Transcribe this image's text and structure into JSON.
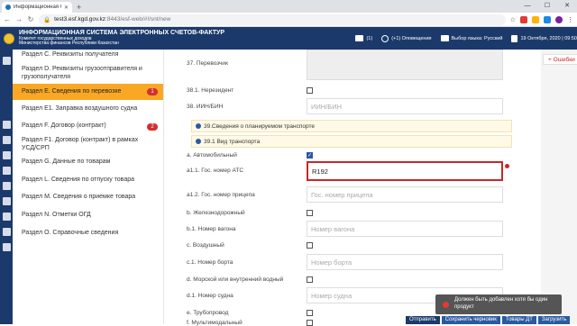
{
  "browser": {
    "tab_title": "Информационная Система Эле",
    "url_host": "test3.esf.kgd.gov.kz",
    "url_path": ":8443/esf-web/#!/snt/new",
    "colors": {
      "tabbar": "#dee1e6"
    }
  },
  "header": {
    "title": "ИНФОРМАЦИОННАЯ СИСТЕМА ЭЛЕКТРОННЫХ СЧЕТОВ-ФАКТУР",
    "subtitle1": "Комитет государственных доходов",
    "subtitle2": "Министерства финансов Республики Казахстан",
    "messages": "(1)",
    "notifications": "(+1) Оповещения",
    "language": "Выбор языка: Русский",
    "datetime": "19 Октября, 2020 | 09:50",
    "color": "#1b3a6b"
  },
  "sidebar": {
    "items": [
      {
        "label": "Раздел C. Реквизиты получателя"
      },
      {
        "label": "Раздел D. Реквизиты грузоотправителя и грузополучателя"
      },
      {
        "label": "Раздел E. Сведения по перевозке",
        "badge": "1",
        "active": true
      },
      {
        "label": "Раздел E1. Заправка воздушного судна"
      },
      {
        "label": "Раздел F. Договор (контракт)",
        "badge": "2"
      },
      {
        "label": "Раздел F1. Договор (контракт) в рамках УСД/СРП"
      },
      {
        "label": "Раздел G. Данные по товарам"
      },
      {
        "label": "Раздел L. Сведения по отпуску товара"
      },
      {
        "label": "Раздел M. Сведения о приемке товара"
      },
      {
        "label": "Раздел N. Отметки ОГД"
      },
      {
        "label": "Раздел O. Справочные сведения"
      }
    ],
    "active_color": "#f9a825"
  },
  "form": {
    "carrier_label": "37. Перевозчик",
    "nonresident_label": "38.1. Нерезидент",
    "iin_label": "38. ИИН/БИН",
    "iin_placeholder": "ИИН/БИН",
    "info1": "39.Сведения о планируемом транспорте",
    "info2": "39.1 Вид транспорта",
    "auto_label": "a. Автомобильный",
    "auto_checked": true,
    "plate_label": "a1.1. Гос. номер АТС",
    "plate_value": "R192",
    "trailer_label": "a1.2. Гос. номер прицепа",
    "trailer_placeholder": "Гос. номер прицепа",
    "rail_label": "b. Железнодорожный",
    "wagon_label": "b.1. Номер вагона",
    "wagon_placeholder": "Номер вагона",
    "air_label": "c. Воздушный",
    "flight_label": "c.1. Номер борта",
    "flight_placeholder": "Номер борта",
    "sea_label": "d. Морской или внутренний водный",
    "ship_label": "d.1. Номер судна",
    "ship_placeholder": "Номер судна",
    "pipe_label": "e. Трубопровод",
    "multi_label": "f. Мультимодальный"
  },
  "errors_button": "+ Ошибки",
  "toast": {
    "line1": "Должен быть добавлен хотя бы один",
    "line2": "продукт"
  },
  "footer": {
    "send": "Отправить",
    "draft": "Сохранить черновик",
    "goods": "Товары ДТ",
    "table": "Загрузить"
  }
}
